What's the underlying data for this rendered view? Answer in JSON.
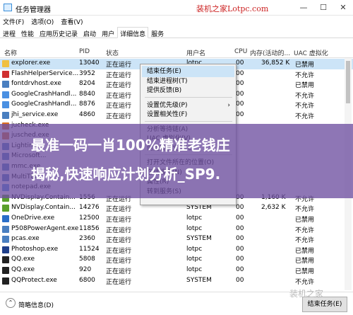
{
  "window": {
    "title": "任务管理器",
    "watermark": "装机之家Lotpc.com",
    "min": "—",
    "max": "☐",
    "close": "✕"
  },
  "menu": [
    "文件(F)",
    "选项(O)",
    "查看(V)"
  ],
  "tabs": [
    "进程",
    "性能",
    "应用历史记录",
    "启动",
    "用户",
    "详细信息",
    "服务"
  ],
  "active_tab": 5,
  "columns": {
    "name": "名称",
    "pid": "PID",
    "status": "状态",
    "user": "用户名",
    "cpu": "CPU",
    "mem": "内存(活动的...",
    "uac": "UAC 虚拟化"
  },
  "rows": [
    {
      "name": "explorer.exe",
      "pid": "13040",
      "status": "正在运行",
      "user": "lotpc",
      "cpu": "00",
      "mem": "36,852 K",
      "uac": "已禁用",
      "color": "#f0c040"
    },
    {
      "name": "FlashHelperService...",
      "pid": "3952",
      "status": "正在运行",
      "user": "",
      "cpu": "00",
      "mem": "",
      "uac": "不允许",
      "color": "#d03030"
    },
    {
      "name": "fontdrvhost.exe",
      "pid": "8204",
      "status": "正在运行",
      "user": "",
      "cpu": "00",
      "mem": "",
      "uac": "已禁用",
      "color": "#4a7fc0"
    },
    {
      "name": "GoogleCrashHandl...",
      "pid": "8840",
      "status": "正在运行",
      "user": "",
      "cpu": "00",
      "mem": "",
      "uac": "不允许",
      "color": "#4a90e2"
    },
    {
      "name": "GoogleCrashHandl...",
      "pid": "8876",
      "status": "正在运行",
      "user": "",
      "cpu": "00",
      "mem": "",
      "uac": "不允许",
      "color": "#4a90e2"
    },
    {
      "name": "jhi_service.exe",
      "pid": "4860",
      "status": "正在运行",
      "user": "",
      "cpu": "00",
      "mem": "",
      "uac": "不允许",
      "color": "#4a7fc0"
    },
    {
      "name": "jucheck.exe",
      "pid": "",
      "status": "",
      "user": "",
      "cpu": "",
      "mem": "",
      "uac": "",
      "color": "#e07020"
    },
    {
      "name": "jusched.exe",
      "pid": "",
      "status": "",
      "user": "",
      "cpu": "",
      "mem": "",
      "uac": "",
      "color": "#e07020"
    },
    {
      "name": "Lighting...",
      "pid": "",
      "status": "",
      "user": "",
      "cpu": "",
      "mem": "",
      "uac": "",
      "color": "#4a7fc0"
    },
    {
      "name": "Microsoft...",
      "pid": "",
      "status": "",
      "user": "",
      "cpu": "",
      "mem": "",
      "uac": "",
      "color": "#4a7fc0"
    },
    {
      "name": "mmc.exe",
      "pid": "",
      "status": "",
      "user": "",
      "cpu": "",
      "mem": "",
      "uac": "",
      "color": "#4a7fc0"
    },
    {
      "name": "MultiTip...",
      "pid": "",
      "status": "",
      "user": "",
      "cpu": "",
      "mem": "",
      "uac": "",
      "color": "#4a7fc0"
    },
    {
      "name": "notepad.exe",
      "pid": "",
      "status": "",
      "user": "",
      "cpu": "",
      "mem": "",
      "uac": "",
      "color": "#4a90e2"
    },
    {
      "name": "NVDisplay.Contain...",
      "pid": "1556",
      "status": "正在运行",
      "user": "",
      "cpu": "00",
      "mem": "1,160 K",
      "uac": "不允许",
      "color": "#5aa02c"
    },
    {
      "name": "NVDisplay.Contain...",
      "pid": "14276",
      "status": "正在运行",
      "user": "SYSTEM",
      "cpu": "00",
      "mem": "2,632 K",
      "uac": "不允许",
      "color": "#5aa02c"
    },
    {
      "name": "OneDrive.exe",
      "pid": "12500",
      "status": "正在运行",
      "user": "lotpc",
      "cpu": "00",
      "mem": "",
      "uac": "已禁用",
      "color": "#2a6ec8"
    },
    {
      "name": "P508PowerAgent.exe",
      "pid": "11856",
      "status": "正在运行",
      "user": "lotpc",
      "cpu": "00",
      "mem": "",
      "uac": "不允许",
      "color": "#4a7fc0"
    },
    {
      "name": "pcas.exe",
      "pid": "2360",
      "status": "正在运行",
      "user": "SYSTEM",
      "cpu": "00",
      "mem": "",
      "uac": "不允许",
      "color": "#4a7fc0"
    },
    {
      "name": "Photoshop.exe",
      "pid": "11524",
      "status": "正在运行",
      "user": "lotpc",
      "cpu": "00",
      "mem": "",
      "uac": "已禁用",
      "color": "#1f3f8a"
    },
    {
      "name": "QQ.exe",
      "pid": "5808",
      "status": "正在运行",
      "user": "lotpc",
      "cpu": "00",
      "mem": "",
      "uac": "已禁用",
      "color": "#222"
    },
    {
      "name": "QQ.exe",
      "pid": "920",
      "status": "正在运行",
      "user": "lotpc",
      "cpu": "00",
      "mem": "",
      "uac": "已禁用",
      "color": "#222"
    },
    {
      "name": "QQProtect.exe",
      "pid": "6800",
      "status": "正在运行",
      "user": "SYSTEM",
      "cpu": "00",
      "mem": "",
      "uac": "不允许",
      "color": "#222"
    }
  ],
  "context_menu": [
    {
      "label": "结束任务(E)",
      "hl": true
    },
    {
      "label": "结束进程树(T)"
    },
    {
      "label": "提供反馈(B)"
    },
    {
      "sep": true
    },
    {
      "label": "设置优先级(P)",
      "sub": true
    },
    {
      "label": "设置相关性(F)"
    },
    {
      "sep": true
    },
    {
      "label": "分析等待链(A)"
    },
    {
      "label": "UAC 虚拟化(V)"
    },
    {
      "label": "创建转储文件(C)"
    },
    {
      "sep": true
    },
    {
      "label": "打开文件所在的位置(O)"
    },
    {
      "label": "在线搜索(N)"
    },
    {
      "label": "属性(R)"
    },
    {
      "label": "转到服务(S)"
    }
  ],
  "banner": {
    "line1": "最准一码一肖100%精准老钱庄",
    "line2": "揭秘,快速响应计划分析_SP9."
  },
  "footer": {
    "less_details": "简略信息(D)",
    "end_task": "结束任务(E)"
  },
  "watermark2": "装机之家"
}
